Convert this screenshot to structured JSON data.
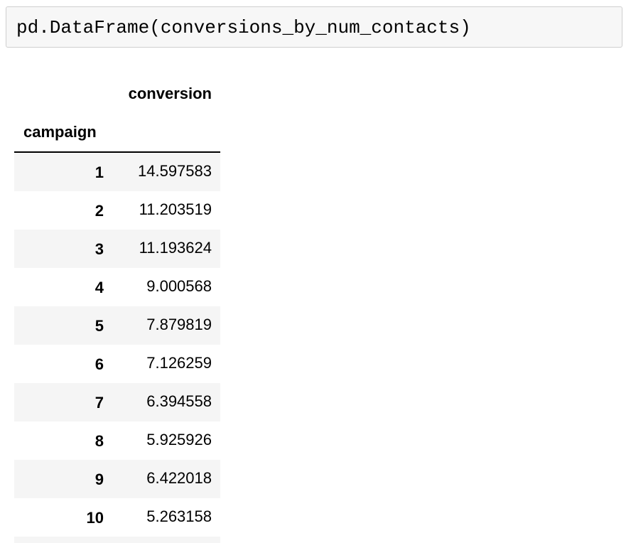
{
  "code_cell": {
    "source": "pd.DataFrame(conversions_by_num_contacts)"
  },
  "dataframe": {
    "column_header": "conversion",
    "index_name": "campaign",
    "rows": [
      {
        "index": "1",
        "value": "14.597583"
      },
      {
        "index": "2",
        "value": "11.203519"
      },
      {
        "index": "3",
        "value": "11.193624"
      },
      {
        "index": "4",
        "value": "9.000568"
      },
      {
        "index": "5",
        "value": "7.879819"
      },
      {
        "index": "6",
        "value": "7.126259"
      },
      {
        "index": "7",
        "value": "6.394558"
      },
      {
        "index": "8",
        "value": "5.925926"
      },
      {
        "index": "9",
        "value": "6.422018"
      },
      {
        "index": "10",
        "value": "5.263158"
      }
    ]
  }
}
